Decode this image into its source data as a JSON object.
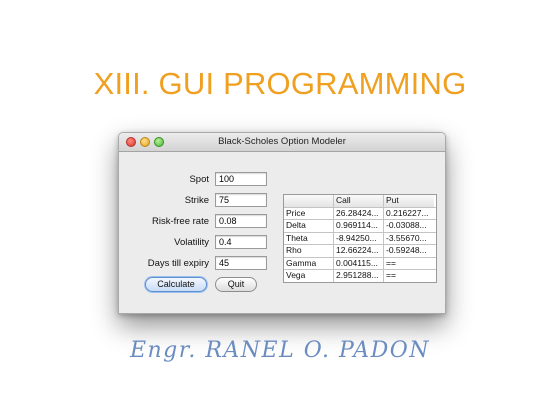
{
  "slide": {
    "title": "XIII. GUI PROGRAMMING",
    "author": "Engr. RANEL O. PADON"
  },
  "window": {
    "title": "Black-Scholes Option Modeler"
  },
  "form": {
    "fields": [
      {
        "label": "Spot",
        "value": "100"
      },
      {
        "label": "Strike",
        "value": "75"
      },
      {
        "label": "Risk-free rate",
        "value": "0.08"
      },
      {
        "label": "Volatility",
        "value": "0.4"
      },
      {
        "label": "Days till expiry",
        "value": "45"
      }
    ]
  },
  "buttons": {
    "calculate": "Calculate",
    "quit": "Quit"
  },
  "greeks_table": {
    "headers": [
      "",
      "Call",
      "Put"
    ],
    "rows": [
      [
        "Price",
        "26.28424...",
        "0.216227..."
      ],
      [
        "Delta",
        "0.969114...",
        "-0.03088..."
      ],
      [
        "Theta",
        "-8.94250...",
        "-3.55670..."
      ],
      [
        "Rho",
        "12.66224...",
        "-0.59248..."
      ],
      [
        "Gamma",
        "0.004115...",
        "=="
      ],
      [
        "Vega",
        "2.951288...",
        "=="
      ]
    ]
  },
  "colors": {
    "title": "#f0a020",
    "author": "#6b8cc0",
    "close": "#d9362e",
    "minimize": "#e0a020",
    "maximize": "#48b830"
  }
}
